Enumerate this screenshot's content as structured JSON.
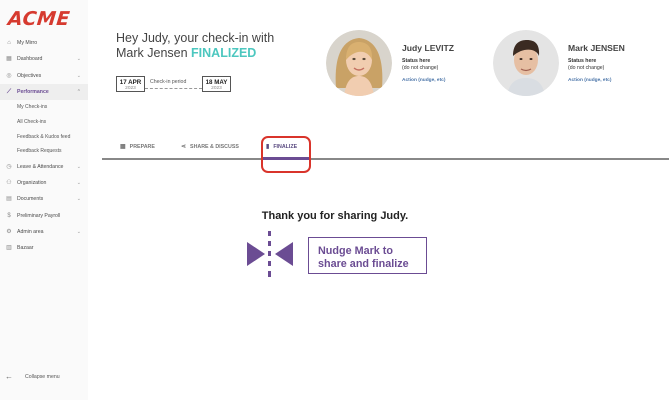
{
  "app": {
    "logo_text": "ACME"
  },
  "sidebar": {
    "items": [
      {
        "label": "My Mirro",
        "icon": "home-icon"
      },
      {
        "label": "Dashboard",
        "icon": "grid-icon",
        "has_chevron": true
      },
      {
        "label": "Objectives",
        "icon": "target-icon",
        "has_chevron": true
      },
      {
        "label": "Performance",
        "icon": "trend-icon",
        "has_chevron": true,
        "active": true
      },
      {
        "label": "Leave & Attendance",
        "icon": "clock-icon",
        "has_chevron": true
      },
      {
        "label": "Organization",
        "icon": "people-icon",
        "has_chevron": true
      },
      {
        "label": "Documents",
        "icon": "document-icon",
        "has_chevron": true
      },
      {
        "label": "Preliminary Payroll",
        "icon": "dollar-icon"
      },
      {
        "label": "Admin area",
        "icon": "gear-icon",
        "has_chevron": true
      },
      {
        "label": "Bazaar",
        "icon": "store-icon"
      }
    ],
    "performance_sub": [
      "My Check-ins",
      "All Check-ins",
      "Feedback & Kudos feed",
      "Feedback Requests"
    ],
    "collapse_label": "Collapse menu"
  },
  "header": {
    "greeting_line1": "Hey Judy, your check-in with",
    "greeting_line2": "Mark Jensen",
    "greeting_status": "FINALIZED",
    "status_color": "#4cc7bf"
  },
  "period": {
    "start_day": "17 APR",
    "start_year": "2023",
    "label": "Check-in period",
    "end_day": "18 MAY",
    "end_year": "2023"
  },
  "people": [
    {
      "name": "Judy LEVITZ",
      "status_title": "Status here",
      "status_sub": "(do not change)",
      "action": "Action (nudge, etc)"
    },
    {
      "name": "Mark JENSEN",
      "status_title": "Status here",
      "status_sub": "(do not change)",
      "action": "Action (nudge, etc)"
    }
  ],
  "tabs": [
    {
      "label": "PREPARE",
      "icon": "grid-icon"
    },
    {
      "label": "SHARE & DISCUSS",
      "icon": "share-icon"
    },
    {
      "label": "FINALIZE",
      "icon": "clipboard-icon",
      "active": true
    }
  ],
  "main": {
    "thanks_message": "Thank you for sharing Judy.",
    "nudge_button_line1": "Nudge Mark to",
    "nudge_button_line2": "share and finalize"
  },
  "colors": {
    "brand_red": "#d63a2f",
    "accent_purple": "#6b4c93",
    "highlight_red": "#d9342b",
    "action_blue": "#4a74a8"
  }
}
